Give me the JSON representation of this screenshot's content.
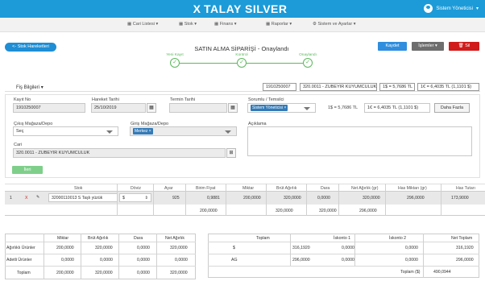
{
  "header": {
    "logo_text": "TALAY SILVER",
    "logo_x": "X",
    "user_name": "Sistem Yöneticisi",
    "user_caret": "▾"
  },
  "menu": [
    {
      "label": "Cari Listesi"
    },
    {
      "label": "Stok"
    },
    {
      "label": "Finans"
    },
    {
      "label": "Raporlar"
    },
    {
      "label": "Sistem ve Ayarlar"
    }
  ],
  "toolbar": {
    "back_label": "<- Stok Hareketleri",
    "title": "SATIN ALMA SİPARİŞİ - Onaylandı",
    "save_label": "Kaydet",
    "ops_label": "İşlemler",
    "delete_label": "Sil"
  },
  "steps": [
    {
      "label": "Yeni Kayıt"
    },
    {
      "label": "Kontrol"
    },
    {
      "label": "Onaylandı"
    }
  ],
  "info": {
    "tab_label": "Fiş Bilgileri",
    "doc_no": "1910250007",
    "cari_name": "320.0011 - ZUBEYIR KUYUMCULUK",
    "usd_rate": "1$ = 5,7686 TL",
    "eur_rate": "1€ = 6,4035 TL (1,1101 $)"
  },
  "form": {
    "kayit_no_label": "Kayıt No",
    "kayit_no": "1910250007",
    "hareket_label": "Hareket Tarihi",
    "hareket_tarihi": "25/10/2019",
    "termin_label": "Termin Tarihi",
    "termin_tarihi": "",
    "sorumlu_label": "Sorumlu / Temsilci",
    "sorumlu_tag": "Sistem Yöneticisi",
    "usd_rate": "1$ = 5,7686 TL",
    "eur_rate": "1€ = 6,4035 TL (1,1101 $)",
    "more_label": "Daha Fazla",
    "cikis_label": "Çıkış Mağaza/Depo",
    "cikis_value": "Seç",
    "giris_label": "Giriş Mağaza/Depo",
    "giris_tag": "Merkez",
    "aciklama_label": "Açıklama",
    "cari_label": "Cari",
    "cari_value": "320.0011 - ZUBEYIR KUYUMCULUK",
    "next_label": "İleri"
  },
  "grid": {
    "headers": [
      "Stok",
      "Döviz",
      "Ayar",
      "Birim Fiyat",
      "Miktar",
      "Brüt Ağırlık",
      "Dara",
      "Net Ağırlık (gr)",
      "Has Miktarı (gr)",
      "Has Tutarı"
    ],
    "row": {
      "index": "1",
      "delete": "X",
      "stok": "32000110013 S Taşlı yüzük",
      "doviz": "$",
      "ayar": "925",
      "birim_fiyat": "0,9881",
      "miktar": "200,0000",
      "brut": "320,0000",
      "dara": "0,0000",
      "net": "320,0000",
      "has_miktar": "296,0000",
      "has_tutar": "173,9000"
    },
    "totals": {
      "miktar": "200,0000",
      "brut": "320,0000",
      "net": "320,0000",
      "has_miktar": "296,0000"
    }
  },
  "summary_left": {
    "headers": [
      "Miktar",
      "Brüt Ağırlık",
      "Dara",
      "Net Ağırlık"
    ],
    "rows": [
      {
        "label": "Ağırlıklı Ürünler",
        "values": [
          "200,0000",
          "320,0000",
          "0,0000",
          "320,0000"
        ]
      },
      {
        "label": "Adetli Ürünler",
        "values": [
          "0,0000",
          "0,0000",
          "0,0000",
          "0,0000"
        ]
      },
      {
        "label": "Toplam",
        "values": [
          "200,0000",
          "320,0000",
          "0,0000",
          "320,0000"
        ]
      }
    ]
  },
  "summary_right": {
    "headers": [
      "Toplam",
      "İskonto 1",
      "İskonto 2",
      "Net Toplam"
    ],
    "rows": [
      {
        "label": "$",
        "values": [
          "316,1920",
          "0,0000",
          "0,0000",
          "316,1920"
        ]
      },
      {
        "label": "AG",
        "values": [
          "296,0000",
          "0,0000",
          "0,0000",
          "296,0000"
        ]
      }
    ],
    "total_label": "Toplam ($)",
    "total_value": "490,0944"
  }
}
